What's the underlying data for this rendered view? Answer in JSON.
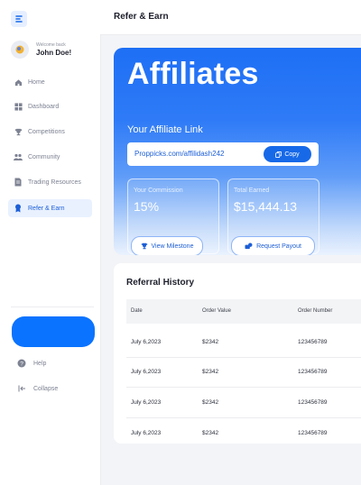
{
  "sidebar": {
    "welcome": "Welcome back",
    "username": "John Doe!",
    "items": [
      {
        "label": "Home",
        "icon": "home-icon"
      },
      {
        "label": "Dashboard",
        "icon": "grid-icon"
      },
      {
        "label": "Competitions",
        "icon": "trophy-icon"
      },
      {
        "label": "Community",
        "icon": "people-icon"
      },
      {
        "label": "Trading Resources",
        "icon": "document-icon"
      },
      {
        "label": "Refer & Earn",
        "icon": "badge-icon"
      }
    ],
    "help": "Help",
    "collapse": "Collapse"
  },
  "header": {
    "title": "Refer & Earn"
  },
  "hero": {
    "title": "Affiliates",
    "link_label": "Your Affiliate Link",
    "link": "Proppicks.com/affilidash242",
    "copy": "Copy",
    "commission_label": "Your Commission",
    "commission_value": "15%",
    "earned_label": "Total Earned",
    "earned_value": "$15,444.13",
    "milestone_btn": "View Milestone",
    "payout_btn": "Request Payout"
  },
  "history": {
    "title": "Referral History",
    "columns": [
      "Date",
      "Order Value",
      "Order Number"
    ],
    "rows": [
      [
        "July 6,2023",
        "$2342",
        "123456789"
      ],
      [
        "July 6,2023",
        "$2342",
        "123456789"
      ],
      [
        "July 6,2023",
        "$2342",
        "123456789"
      ],
      [
        "July 6,2023",
        "$2342",
        "123456789"
      ]
    ]
  },
  "colors": {
    "accent": "#0a73ff",
    "active_bg": "#e9f1ff"
  }
}
